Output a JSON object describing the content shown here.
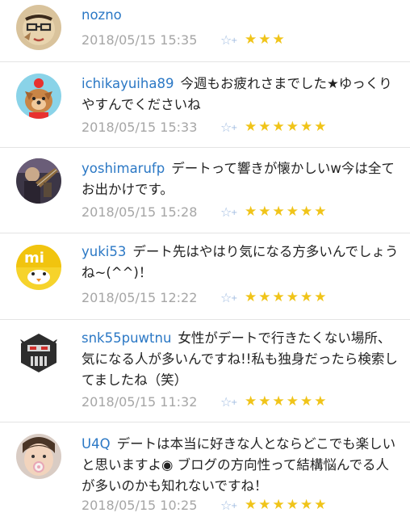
{
  "comments": [
    {
      "user": "nozno",
      "text": "",
      "date": "2018/05/15 15:35",
      "stars": "★★★"
    },
    {
      "user": "ichikayuiha89",
      "text": "今週もお疲れさまでした★ゆっくりやすんでくださいね",
      "date": "2018/05/15 15:33",
      "stars": "★★★★★★"
    },
    {
      "user": "yoshimarufp",
      "text": "デートって響きが懐かしいw今は全てお出かけです。",
      "date": "2018/05/15 15:28",
      "stars": "★★★★★★"
    },
    {
      "user": "yuki53",
      "text": "デート先はやはり気になる方多いんでしょうね~(^^)！",
      "date": "2018/05/15 12:22",
      "stars": "★★★★★★"
    },
    {
      "user": "snk55puwtnu",
      "text": "女性がデートで行きたくない場所、気になる人が多いんですね!!私も独身だったら検索してましたね（笑）",
      "date": "2018/05/15 11:32",
      "stars": "★★★★★★"
    },
    {
      "user": "U4Q",
      "text": "デートは本当に好きな人とならどこでも楽しいと思いますよ◉ ブログの方向性って結構悩んでる人が多いのかも知れないですね！",
      "date": "2018/05/15 10:25",
      "stars": "★★★★★★"
    }
  ],
  "star_add_icon": "☆+"
}
